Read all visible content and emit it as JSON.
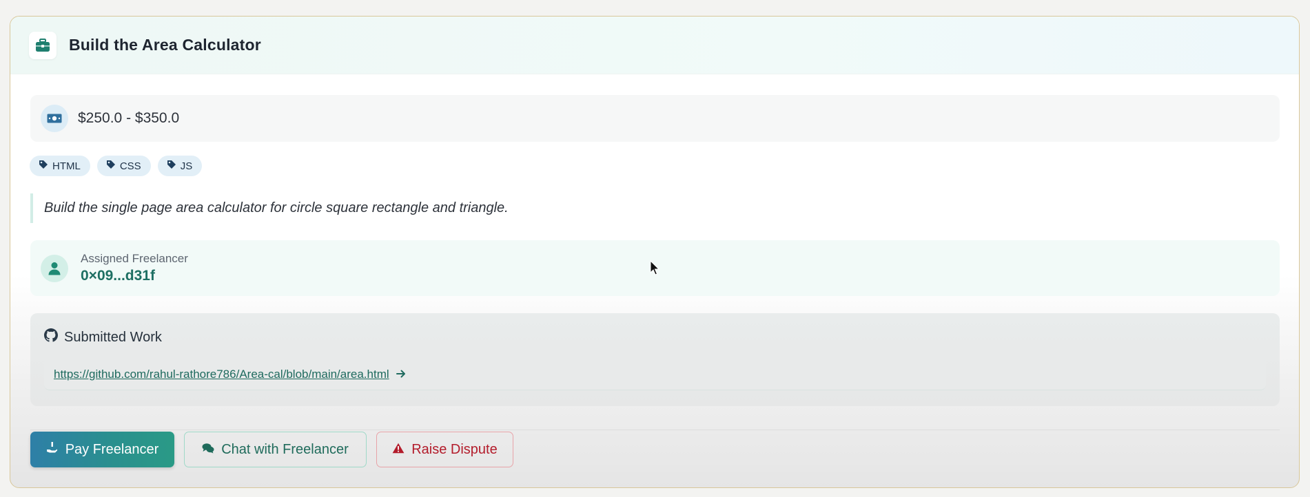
{
  "project": {
    "title": "Build the Area Calculator",
    "budget": "$250.0 - $350.0",
    "tags": [
      "HTML",
      "CSS",
      "JS"
    ],
    "description": "Build the single page area calculator for circle square rectangle and triangle."
  },
  "freelancer": {
    "label": "Assigned Freelancer",
    "address": "0×09...d31f"
  },
  "submitted_work": {
    "title": "Submitted Work",
    "link": "https://github.com/rahul-rathore786/Area-cal/blob/main/area.html"
  },
  "actions": {
    "pay_label": "Pay Freelancer",
    "chat_label": "Chat with Freelancer",
    "dispute_label": "Raise Dispute"
  },
  "icons": {
    "header": "briefcase-icon",
    "budget": "money-bill-icon",
    "tag": "tag-icon",
    "freelancer": "user-icon",
    "submitted": "github-icon",
    "link_arrow": "arrow-right-icon",
    "pay": "hand-holding-dollar-icon",
    "chat": "comments-icon",
    "dispute": "warning-triangle-icon"
  },
  "colors": {
    "accent": "#1e6f63",
    "budget_icon": "#2f6f9d",
    "dispute": "#b31c2b",
    "card_border": "#d8c79a"
  }
}
